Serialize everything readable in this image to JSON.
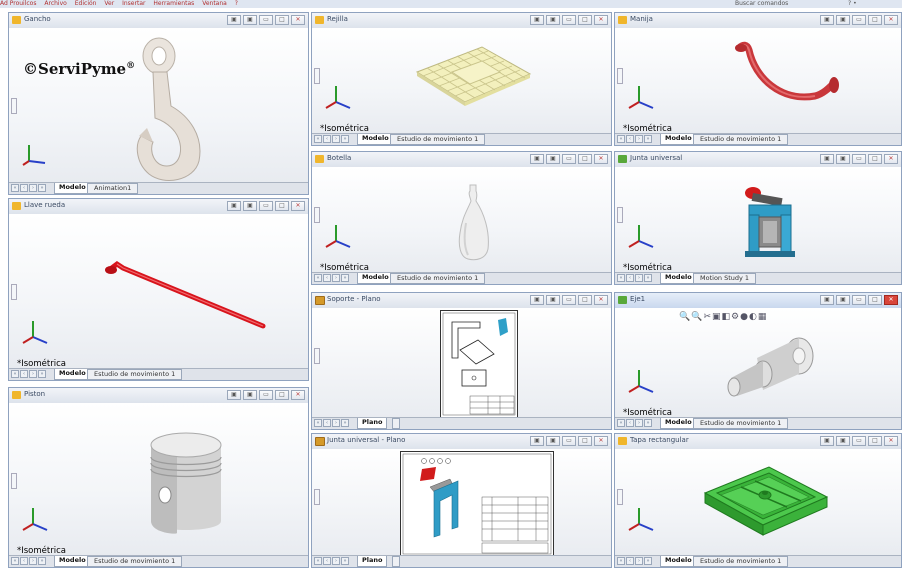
{
  "menubar": {
    "app": "Ad Prouilcos",
    "items": [
      "Archivo",
      "Edición",
      "Ver",
      "Insertar",
      "Herramientas",
      "Ventana",
      "?"
    ],
    "search_placeholder": "Buscar comandos",
    "help": "? •"
  },
  "watermark": {
    "text": "©ServiPyme",
    "mark": "®"
  },
  "common": {
    "view_label": "*Isométrica",
    "tab_modelo": "Modelo",
    "tab_plano": "Plano",
    "tab_motion": "Estudio de movimiento 1",
    "tab_animation": "Animation1",
    "tab_motion_study": "Motion Study 1",
    "buttons": [
      "▣",
      "▣",
      "▭",
      "□",
      "✕"
    ]
  },
  "windows": [
    {
      "id": "gancho",
      "title": "Gancho"
    },
    {
      "id": "rejilla",
      "title": "Rejilla"
    },
    {
      "id": "manija",
      "title": "Manija"
    },
    {
      "id": "botella",
      "title": "Botella"
    },
    {
      "id": "junta",
      "title": "Junta universal"
    },
    {
      "id": "llave",
      "title": "Llave rueda"
    },
    {
      "id": "soporte",
      "title": "Soporte - Plano"
    },
    {
      "id": "eje",
      "title": "Eje1"
    },
    {
      "id": "piston",
      "title": "Piston"
    },
    {
      "id": "junta_plano",
      "title": "Junta universal - Plano"
    },
    {
      "id": "tapa",
      "title": "Tapa rectangular"
    }
  ],
  "colors": {
    "hook": "#e9e3dc",
    "grid": "#f1efb7",
    "handle": "#c7393c",
    "wrench": "#e2121b",
    "bottle": "#ececec",
    "clamp_blue": "#2f9cc6",
    "piston": "#d7d7d7",
    "tray": "#3fbf3f"
  }
}
